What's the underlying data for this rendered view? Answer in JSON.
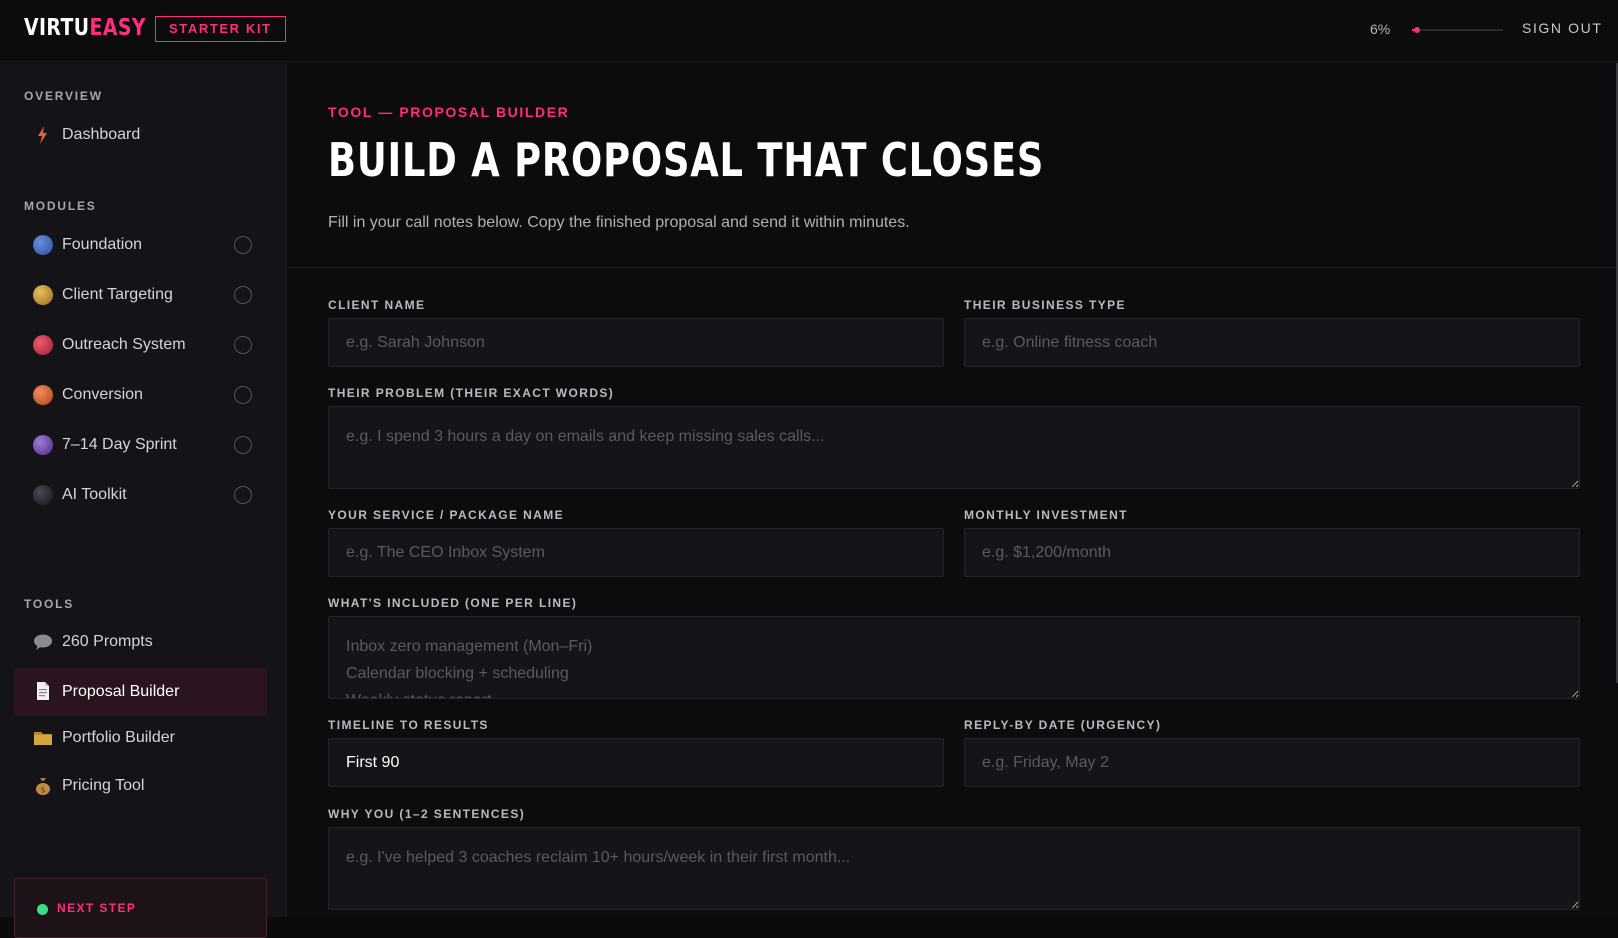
{
  "brand": {
    "logo_part1": "VIRTU",
    "logo_part2": "EASY",
    "badge": "STARTER KIT"
  },
  "header": {
    "progress_label": "6%",
    "progress_value": 0.06,
    "sign_out": "SIGN OUT"
  },
  "sidebar": {
    "overview_label": "OVERVIEW",
    "dashboard": {
      "label": "Dashboard",
      "icon": "lightning-icon"
    },
    "modules_label": "MODULES",
    "modules": [
      {
        "label": "Foundation",
        "color": "#3d63b8"
      },
      {
        "label": "Client Targeting",
        "color": "#c9962e"
      },
      {
        "label": "Outreach System",
        "color": "#c8324a"
      },
      {
        "label": "Conversion",
        "color": "#d2602a"
      },
      {
        "label": "7–14 Day Sprint",
        "color": "#7548b0"
      },
      {
        "label": "AI Toolkit",
        "color": "#2c2a33"
      }
    ],
    "tools_label": "TOOLS",
    "tools": [
      {
        "label": "260 Prompts",
        "icon": "speech-bubble-icon"
      },
      {
        "label": "Proposal Builder",
        "icon": "document-icon",
        "active": true
      },
      {
        "label": "Portfolio Builder",
        "icon": "folder-icon"
      },
      {
        "label": "Pricing Tool",
        "icon": "money-bag-icon"
      }
    ],
    "next_step": "NEXT STEP"
  },
  "main": {
    "eyebrow": "TOOL — PROPOSAL BUILDER",
    "title": "BUILD A PROPOSAL THAT CLOSES",
    "subtitle": "Fill in your call notes below. Copy the finished proposal and send it within minutes."
  },
  "form": {
    "client_name": {
      "label": "CLIENT NAME",
      "placeholder": "e.g. Sarah Johnson",
      "value": ""
    },
    "business_type": {
      "label": "THEIR BUSINESS TYPE",
      "placeholder": "e.g. Online fitness coach",
      "value": ""
    },
    "problem": {
      "label": "THEIR PROBLEM (THEIR EXACT WORDS)",
      "placeholder": "e.g. I spend 3 hours a day on emails and keep missing sales calls...",
      "value": ""
    },
    "service_name": {
      "label": "YOUR SERVICE / PACKAGE NAME",
      "placeholder": "e.g. The CEO Inbox System",
      "value": ""
    },
    "investment": {
      "label": "MONTHLY INVESTMENT",
      "placeholder": "e.g. $1,200/month",
      "value": ""
    },
    "included": {
      "label": "WHAT'S INCLUDED (ONE PER LINE)",
      "placeholder": "Inbox zero management (Mon–Fri)\nCalendar blocking + scheduling\nWeekly status report",
      "value": ""
    },
    "timeline": {
      "label": "TIMELINE TO RESULTS",
      "placeholder": "",
      "value": "First 90"
    },
    "reply_by": {
      "label": "REPLY-BY DATE (URGENCY)",
      "placeholder": "e.g. Friday, May 2",
      "value": ""
    },
    "why_you": {
      "label": "WHY YOU (1–2 SENTENCES)",
      "placeholder": "e.g. I've helped 3 coaches reclaim 10+ hours/week in their first month...",
      "value": ""
    }
  }
}
